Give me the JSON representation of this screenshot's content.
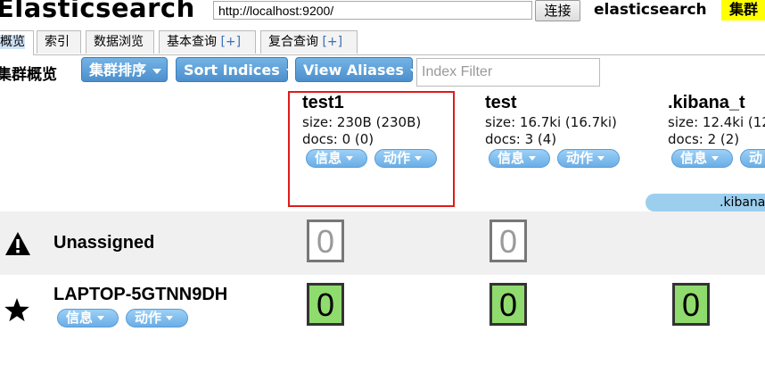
{
  "header": {
    "app_title": "Elasticsearch",
    "url_value": "http://localhost:9200/",
    "connect_label": "连接",
    "cluster_name": "elasticsearch",
    "health_label": "集群"
  },
  "tabs": [
    {
      "label": "概览",
      "plus": ""
    },
    {
      "label": "索引",
      "plus": ""
    },
    {
      "label": "数据浏览",
      "plus": ""
    },
    {
      "label": "基本查询 ",
      "plus": "[+]"
    },
    {
      "label": "复合查询 ",
      "plus": "[+]"
    }
  ],
  "toolbar": {
    "title": "集群概览",
    "cluster_sort_label": "集群排序",
    "sort_indices_label": "Sort Indices",
    "view_aliases_label": "View Aliases",
    "index_filter_placeholder": "Index Filter"
  },
  "indices": [
    {
      "name": "test1",
      "size": "size: 230B (230B)",
      "docs": "docs: 0 (0)",
      "info_label": "信息",
      "action_label": "动作"
    },
    {
      "name": "test",
      "size": "size: 16.7ki (16.7ki)",
      "docs": "docs: 3 (4)",
      "info_label": "信息",
      "action_label": "动作"
    },
    {
      "name": ".kibana_t",
      "size": "size: 12.4ki (12",
      "docs": "docs: 2 (2)",
      "info_label": "信息",
      "action_label": "动"
    }
  ],
  "alias_bar_label": ".kibana",
  "rows": {
    "unassigned": {
      "label": "Unassigned",
      "icon": "warning-icon",
      "shards": [
        "0",
        "0"
      ]
    },
    "node": {
      "label": "LAPTOP-5GTNN9DH",
      "icon": "star-icon",
      "info_label": "信息",
      "action_label": "动作",
      "shards": [
        "0",
        "0",
        "0"
      ]
    }
  },
  "colors": {
    "accent_button": "#4c8fcc",
    "pill": "#6aaee6",
    "health_yellow": "#ffff00",
    "shard_green": "#8fdb6e",
    "selection_red": "#e01b1b"
  }
}
